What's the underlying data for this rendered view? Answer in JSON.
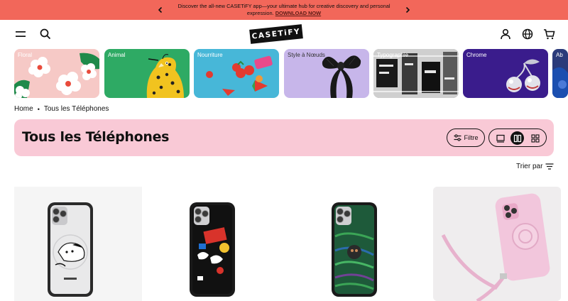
{
  "promo": {
    "text": "Discover the all-new CASETiFY app—your ultimate hub for creative discovery and personal expression.",
    "link": "DOWNLOAD NOW",
    "prev_icon": "chevron-left-icon",
    "next_icon": "chevron-right-icon"
  },
  "header": {
    "logo_text": "CASETiFY",
    "menu_icon": "menu-icon",
    "search_icon": "search-icon",
    "account_icon": "user-icon",
    "language_icon": "globe-icon",
    "cart_icon": "cart-icon"
  },
  "categories": [
    {
      "label": "Floral",
      "color": "#f6c9c6"
    },
    {
      "label": "Animal",
      "color": "#2eaa64"
    },
    {
      "label": "Nourriture",
      "color": "#47b7d8"
    },
    {
      "label": "Style à Nœuds",
      "color": "#c7b6ea"
    },
    {
      "label": "Typographie",
      "color": "#b8b8b8"
    },
    {
      "label": "Chrome",
      "color": "#3a1c8c"
    },
    {
      "label": "Ab",
      "color": "#2a3a7a"
    }
  ],
  "breadcrumb": {
    "home": "Home",
    "separator": "•",
    "current": "Tous les Téléphones"
  },
  "page": {
    "title": "Tous les Téléphones",
    "filter_label": "Filtre",
    "sort_label": "Trier par"
  },
  "colors": {
    "promo_bg": "#f2675a",
    "title_bg": "#f9c9d6"
  }
}
